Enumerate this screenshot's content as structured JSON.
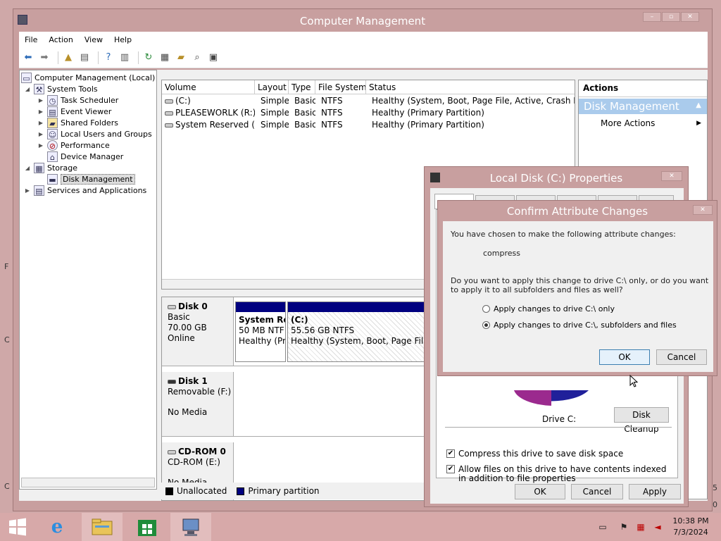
{
  "desktop": {
    "edge_letters": [
      "F",
      "C",
      "C"
    ],
    "edge_digits": [
      "5",
      "0"
    ]
  },
  "main_window": {
    "title": "Computer Management",
    "menu": [
      "File",
      "Action",
      "View",
      "Help"
    ]
  },
  "tree": {
    "root": "Computer Management (Local)",
    "system_tools": "System Tools",
    "task_scheduler": "Task Scheduler",
    "event_viewer": "Event Viewer",
    "shared_folders": "Shared Folders",
    "local_users": "Local Users and Groups",
    "performance": "Performance",
    "device_manager": "Device Manager",
    "storage": "Storage",
    "disk_management": "Disk Management",
    "services": "Services and Applications"
  },
  "volumes": {
    "columns": [
      "Volume",
      "Layout",
      "Type",
      "File System",
      "Status"
    ],
    "rows": [
      [
        "(C:)",
        "Simple",
        "Basic",
        "NTFS",
        "Healthy (System, Boot, Page File, Active, Crash Dump,"
      ],
      [
        "PLEASEWORLK (R:)",
        "Simple",
        "Basic",
        "NTFS",
        "Healthy (Primary Partition)"
      ],
      [
        "System Reserved (D:)",
        "Simple",
        "Basic",
        "NTFS",
        "Healthy (Primary Partition)"
      ]
    ]
  },
  "disks": {
    "disk0": {
      "name": "Disk 0",
      "type": "Basic",
      "size": "70.00 GB",
      "status": "Online",
      "part1": {
        "name": "System Re",
        "size": "50 MB NTF",
        "status": "Healthy (Pr"
      },
      "part2": {
        "name": "(C:)",
        "size": "55.56 GB NTFS",
        "status": "Healthy (System, Boot, Page File, Ac"
      }
    },
    "disk1": {
      "name": "Disk 1",
      "type": "Removable (F:)",
      "status": "No Media"
    },
    "cdrom0": {
      "name": "CD-ROM 0",
      "type": "CD-ROM (E:)",
      "status": "No Media"
    },
    "legend": {
      "unallocated": "Unallocated",
      "primary": "Primary partition",
      "unallocated_color": "#000000",
      "primary_color": "#00007f"
    }
  },
  "actions": {
    "title": "Actions",
    "section": "Disk Management",
    "more": "More Actions"
  },
  "properties": {
    "title": "Local Disk (C:) Properties",
    "drive_label": "Drive C:",
    "disk_cleanup": "Disk Cleanup",
    "compress_label": "Compress this drive to save disk space",
    "index_label": "Allow files on this drive to have contents indexed in addition to file properties",
    "ok": "OK",
    "cancel": "Cancel",
    "apply": "Apply"
  },
  "confirm": {
    "title": "Confirm Attribute Changes",
    "intro": "You have chosen to make the following attribute changes:",
    "change": "compress",
    "question": "Do you want to apply this change to drive C:\\ only, or do you want to apply it to all subfolders and files as well?",
    "option_only": "Apply changes to drive C:\\ only",
    "option_all": "Apply changes to drive C:\\, subfolders and files",
    "ok": "OK",
    "cancel": "Cancel"
  },
  "taskbar": {
    "time": "10:38 PM",
    "date": "7/3/2024"
  }
}
